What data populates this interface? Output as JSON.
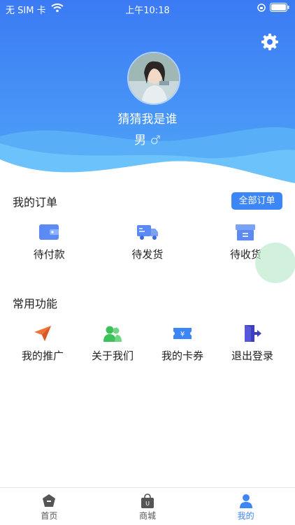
{
  "status_bar": {
    "carrier": "无 SIM 卡",
    "time": "上午10:18"
  },
  "profile": {
    "username": "猜猜我是谁",
    "gender": "男",
    "gender_symbol": "♂"
  },
  "orders": {
    "title": "我的订单",
    "all_button": "全部订单",
    "items": [
      {
        "label": "待付款",
        "icon": "wallet-icon"
      },
      {
        "label": "待发货",
        "icon": "truck-icon"
      },
      {
        "label": "待收货",
        "icon": "box-icon"
      }
    ]
  },
  "functions": {
    "title": "常用功能",
    "items": [
      {
        "label": "我的推广",
        "icon": "paper-plane-icon"
      },
      {
        "label": "关于我们",
        "icon": "users-icon"
      },
      {
        "label": "我的卡券",
        "icon": "ticket-icon"
      },
      {
        "label": "退出登录",
        "icon": "logout-icon"
      }
    ]
  },
  "tabs": [
    {
      "label": "首页",
      "icon": "home-icon",
      "active": false
    },
    {
      "label": "商城",
      "icon": "shopping-bag-icon",
      "active": false
    },
    {
      "label": "我的",
      "icon": "person-icon",
      "active": true
    }
  ],
  "colors": {
    "header_blue": "#3d7ef5",
    "accent": "#3d86f6"
  }
}
